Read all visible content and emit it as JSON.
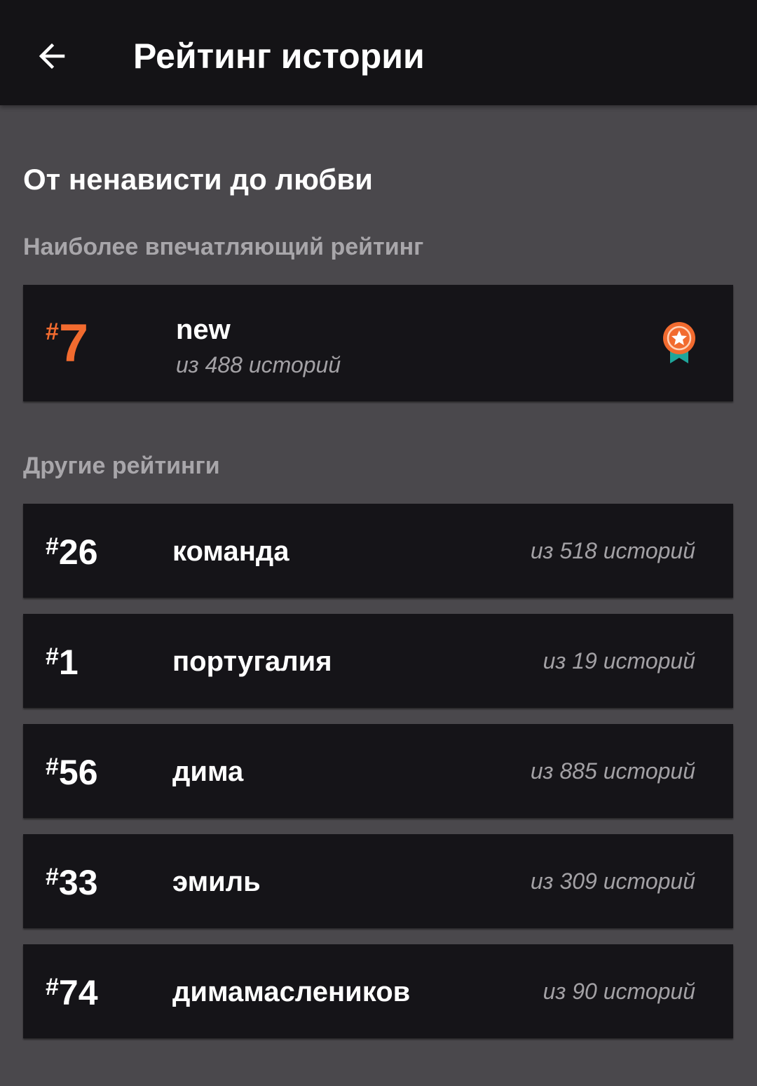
{
  "app_bar": {
    "back_icon": "arrow-left-icon",
    "title": "Рейтинг истории"
  },
  "story": {
    "title": "От ненависти до любви"
  },
  "featured": {
    "section_label": "Наиболее впечатляющий рейтинг",
    "hash": "#",
    "rank": "7",
    "name": "new",
    "count": "из 488 историй",
    "badge_icon": "award-ribbon-icon",
    "rank_color": "#f26b2f"
  },
  "others": {
    "section_label": "Другие рейтинги",
    "items": [
      {
        "hash": "#",
        "rank": "26",
        "name": "команда",
        "count": "из 518 историй"
      },
      {
        "hash": "#",
        "rank": "1",
        "name": "португалия",
        "count": "из 19 историй"
      },
      {
        "hash": "#",
        "rank": "56",
        "name": "дима",
        "count": "из 885 историй"
      },
      {
        "hash": "#",
        "rank": "33",
        "name": "эмиль",
        "count": "из 309 историй"
      },
      {
        "hash": "#",
        "rank": "74",
        "name": "димамаслеников",
        "count": "из 90 историй"
      }
    ]
  },
  "colors": {
    "app_bar_bg": "#141316",
    "page_bg": "#4a484c",
    "card_bg": "#151418",
    "accent": "#f26b2f",
    "ribbon": "#1fa59a",
    "secondary_text": "#a3a1a5"
  }
}
